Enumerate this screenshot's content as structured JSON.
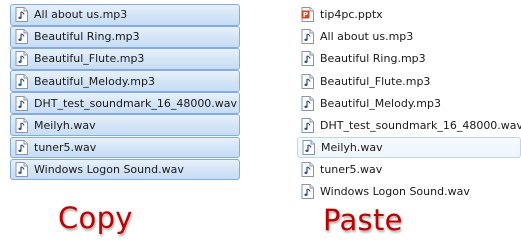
{
  "copy_panel": {
    "files": [
      {
        "name": "All about us.mp3",
        "type": "audio"
      },
      {
        "name": "Beautiful Ring.mp3",
        "type": "audio"
      },
      {
        "name": "Beautiful_Flute.mp3",
        "type": "audio"
      },
      {
        "name": "Beautiful_Melody.mp3",
        "type": "audio"
      },
      {
        "name": "DHT_test_soundmark_16_48000.wav",
        "type": "audio"
      },
      {
        "name": "Meilyh.wav",
        "type": "audio"
      },
      {
        "name": "tuner5.wav",
        "type": "audio"
      },
      {
        "name": "Windows Logon Sound.wav",
        "type": "audio"
      }
    ],
    "caption": "Copy"
  },
  "paste_panel": {
    "files": [
      {
        "name": "tip4pc.pptx",
        "type": "powerpoint"
      },
      {
        "name": "All about us.mp3",
        "type": "audio"
      },
      {
        "name": "Beautiful Ring.mp3",
        "type": "audio"
      },
      {
        "name": "Beautiful_Flute.mp3",
        "type": "audio"
      },
      {
        "name": "Beautiful_Melody.mp3",
        "type": "audio"
      },
      {
        "name": "DHT_test_soundmark_16_48000.wav",
        "type": "audio"
      },
      {
        "name": "Meilyh.wav",
        "type": "audio"
      },
      {
        "name": "tuner5.wav",
        "type": "audio"
      },
      {
        "name": "Windows Logon Sound.wav",
        "type": "audio"
      }
    ],
    "caption": "Paste"
  },
  "colors": {
    "caption": "#c00000",
    "selection_border": "#84acdd",
    "selection_fill": "#d4e5f7"
  }
}
